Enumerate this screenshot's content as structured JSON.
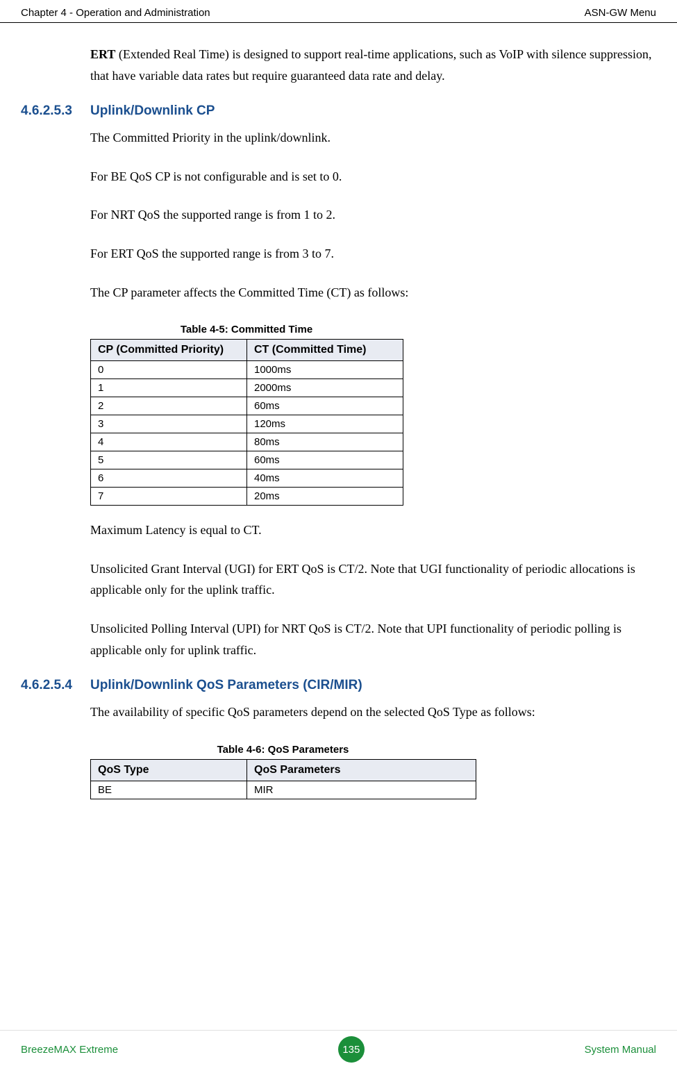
{
  "header": {
    "left": "Chapter 4 - Operation and Administration",
    "right": "ASN-GW Menu"
  },
  "intro": {
    "bold": "ERT",
    "text": " (Extended Real Time) is designed to support real-time applications, such as VoIP with silence suppression, that have variable data rates but require guaranteed data rate and delay."
  },
  "section1": {
    "num": "4.6.2.5.3",
    "title": "Uplink/Downlink CP",
    "p1": "The Committed Priority in the uplink/downlink.",
    "p2": "For BE QoS CP is not configurable and is set to 0.",
    "p3": "For NRT QoS the supported range is from 1 to 2.",
    "p4": "For ERT QoS the supported range is from 3 to 7.",
    "p5": "The CP parameter affects the Committed Time (CT) as follows:"
  },
  "table45": {
    "caption": "Table 4-5: Committed Time",
    "header1": "CP (Committed Priority)",
    "header2": "CT (Committed Time)",
    "rows": [
      {
        "cp": "0",
        "ct": "1000ms"
      },
      {
        "cp": "1",
        "ct": "2000ms"
      },
      {
        "cp": "2",
        "ct": "60ms"
      },
      {
        "cp": "3",
        "ct": "120ms"
      },
      {
        "cp": "4",
        "ct": "80ms"
      },
      {
        "cp": "5",
        "ct": "60ms"
      },
      {
        "cp": "6",
        "ct": "40ms"
      },
      {
        "cp": "7",
        "ct": "20ms"
      }
    ]
  },
  "aftertable": {
    "p1": "Maximum Latency is equal to CT.",
    "p2": "Unsolicited Grant Interval (UGI) for ERT QoS is CT/2. Note that UGI functionality of periodic allocations is applicable only for the uplink traffic.",
    "p3": "Unsolicited Polling Interval (UPI) for NRT QoS is CT/2. Note that UPI functionality of periodic polling is applicable only for uplink traffic."
  },
  "section2": {
    "num": "4.6.2.5.4",
    "title": "Uplink/Downlink QoS Parameters (CIR/MIR)",
    "p1": "The availability of specific QoS parameters depend on the selected QoS Type as follows:"
  },
  "table46": {
    "caption": "Table 4-6: QoS Parameters",
    "header1": "QoS Type",
    "header2": "QoS Parameters",
    "rows": [
      {
        "type": "BE",
        "params": "MIR"
      }
    ]
  },
  "footer": {
    "left": "BreezeMAX Extreme",
    "page": "135",
    "right": "System Manual"
  }
}
